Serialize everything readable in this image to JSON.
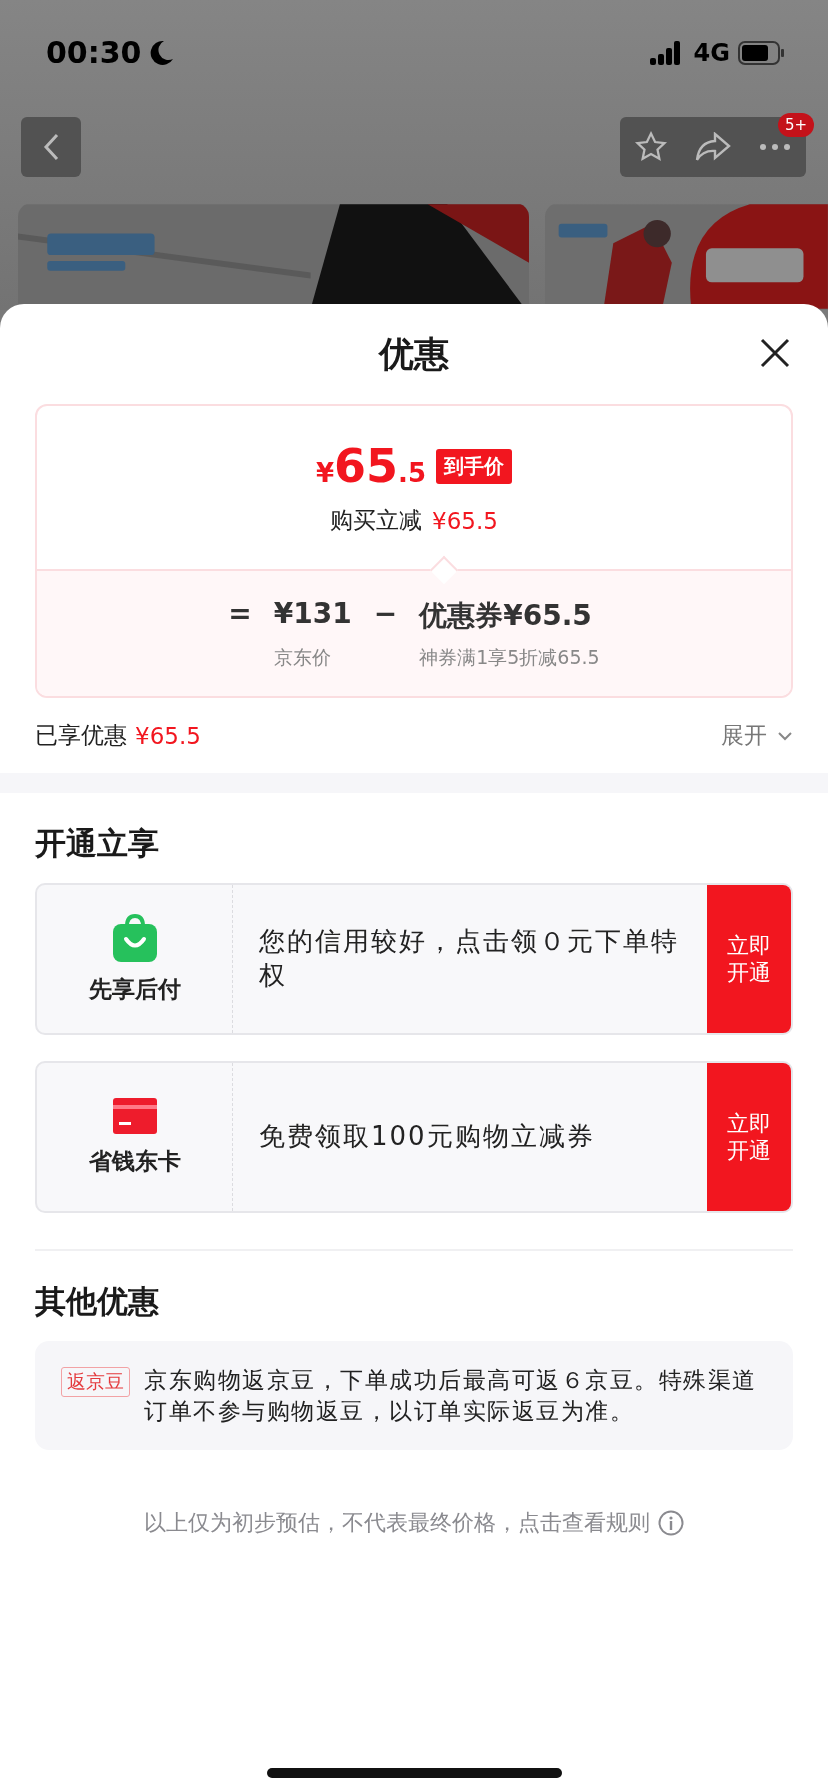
{
  "status_bar": {
    "time": "00:30",
    "network": "4G"
  },
  "nav": {
    "badge": "5+"
  },
  "sheet": {
    "title": "优惠"
  },
  "price_card": {
    "currency": "¥",
    "integer": "65",
    "decimal": ".5",
    "tag": "到手价",
    "subtitle": "购买立减",
    "subtitle_amount": "¥65.5",
    "breakdown": {
      "equals": "=",
      "base_price": "¥131",
      "base_label": "京东价",
      "minus": "−",
      "coupon": "优惠券¥65.5",
      "coupon_label": "神券满1享5折减65.5"
    }
  },
  "savings": {
    "label": "已享优惠",
    "amount": "¥65.5",
    "expand": "展开"
  },
  "open_section": {
    "title": "开通立享",
    "offers": [
      {
        "kind": "bag",
        "name": "先享后付",
        "description": "您的信用较好，点击领０元下单特权",
        "button": "立即开通"
      },
      {
        "kind": "card",
        "name": "省钱东卡",
        "description": "免费领取100元购物立减券",
        "button": "立即开通"
      }
    ]
  },
  "other_section": {
    "title": "其他优惠",
    "items": [
      {
        "tag": "返京豆",
        "text": "京东购物返京豆，下单成功后最高可返６京豆。特殊渠道订单不参与购物返豆，以订单实际返豆为准。"
      }
    ]
  },
  "footnote": "以上仅为初步预估，不代表最终价格，点击查看规则"
}
